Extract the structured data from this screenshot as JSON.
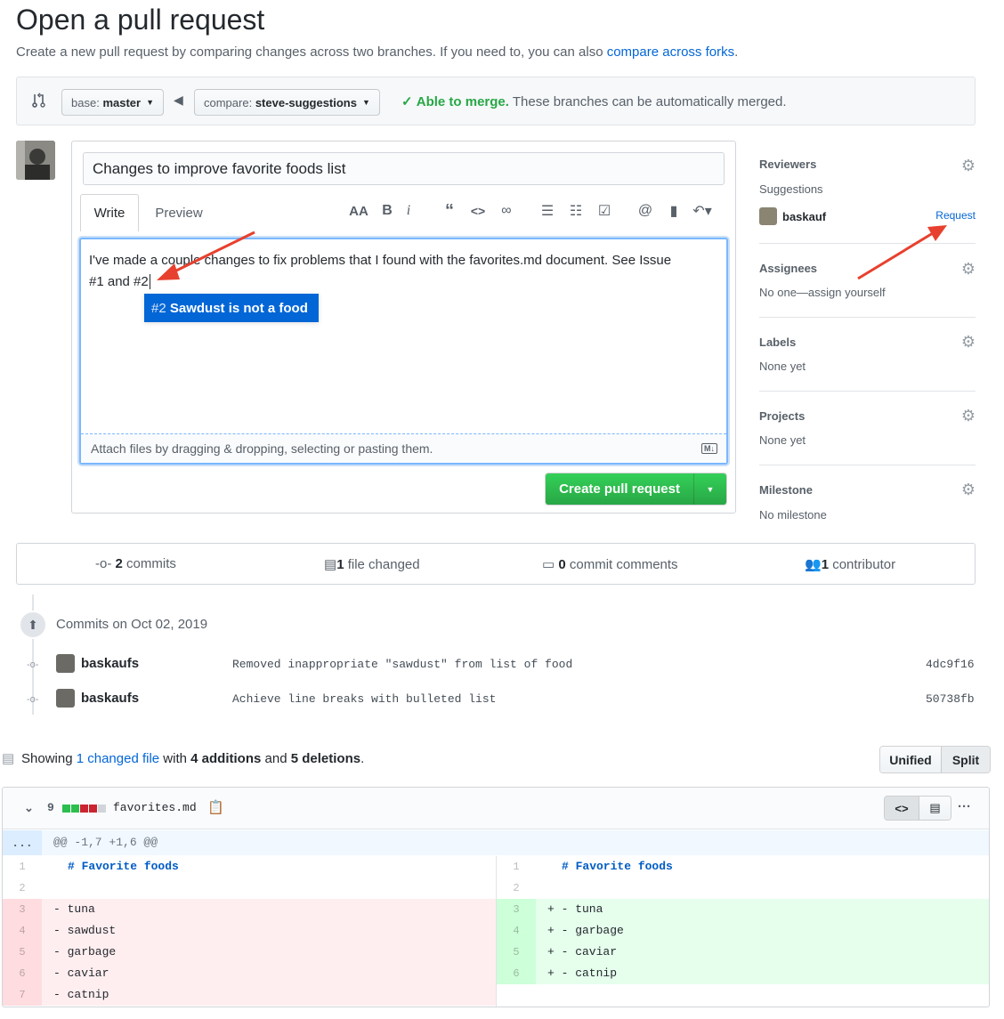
{
  "page": {
    "title": "Open a pull request",
    "subtitle_prefix": "Create a new pull request by comparing changes across two branches. If you need to, you can also",
    "subtitle_link": "compare across forks",
    "subtitle_suffix": "."
  },
  "compare_bar": {
    "base_label": "base:",
    "base_value": "master",
    "compare_label": "compare:",
    "compare_value": "steve-suggestions",
    "merge_status": "Able to merge.",
    "merge_detail": "These branches can be automatically merged."
  },
  "form": {
    "title_value": "Changes to improve favorite foods list",
    "tab_write": "Write",
    "tab_preview": "Preview",
    "body_text_line1": "I've made a couple changes to fix problems that I found with the favorites.md document.  See Issue",
    "body_text_line2": "#1 and #2",
    "suggestion_number": "#2",
    "suggestion_title": "Sawdust is not a food",
    "attach_text": "Attach files by dragging & dropping, selecting or pasting them.",
    "create_button": "Create pull request"
  },
  "sidebar": {
    "reviewers_title": "Reviewers",
    "suggestions_label": "Suggestions",
    "suggested_user": "baskauf",
    "request_link": "Request",
    "assignees_title": "Assignees",
    "assignees_value": "No one—assign yourself",
    "labels_title": "Labels",
    "labels_value": "None yet",
    "projects_title": "Projects",
    "projects_value": "None yet",
    "milestone_title": "Milestone",
    "milestone_value": "No milestone"
  },
  "stats": {
    "commits_count": "2",
    "commits_label": "commits",
    "files_count": "1",
    "files_label": "file changed",
    "comments_count": "0",
    "comments_label": "commit comments",
    "contributors_count": "1",
    "contributors_label": "contributor"
  },
  "commits": {
    "date_heading": "Commits on Oct 02, 2019",
    "items": [
      {
        "author": "baskaufs",
        "message": "Removed inappropriate \"sawdust\" from list of food",
        "sha": "4dc9f16"
      },
      {
        "author": "baskaufs",
        "message": "Achieve line breaks with bulleted list",
        "sha": "50738fb"
      }
    ]
  },
  "diff_summary": {
    "showing": "Showing",
    "changed_file_link": "1 changed file",
    "with": "with",
    "additions": "4 additions",
    "and": "and",
    "deletions": "5 deletions",
    "period": ".",
    "btn_unified": "Unified",
    "btn_split": "Split"
  },
  "file": {
    "change_count": "9",
    "filename": "favorites.md",
    "hunk_header": "@@ -1,7 +1,6 @@",
    "expand": "...",
    "left_lines": [
      {
        "num": "1",
        "text": "# Favorite foods",
        "type": "context"
      },
      {
        "num": "2",
        "text": "",
        "type": "context"
      },
      {
        "num": "3",
        "text": "- tuna",
        "type": "del"
      },
      {
        "num": "4",
        "text": "- sawdust",
        "type": "del"
      },
      {
        "num": "5",
        "text": "- garbage",
        "type": "del"
      },
      {
        "num": "6",
        "text": "- caviar",
        "type": "del"
      },
      {
        "num": "7",
        "text": "- catnip",
        "type": "del"
      }
    ],
    "right_lines": [
      {
        "num": "1",
        "text": "# Favorite foods",
        "type": "context"
      },
      {
        "num": "2",
        "text": "",
        "type": "context"
      },
      {
        "num": "3",
        "text": "+ - tuna",
        "type": "add"
      },
      {
        "num": "4",
        "text": "+ - garbage",
        "type": "add"
      },
      {
        "num": "5",
        "text": "+ - caviar",
        "type": "add"
      },
      {
        "num": "6",
        "text": "+ - catnip",
        "type": "add"
      }
    ]
  },
  "colors": {
    "green": "#2cbe4e",
    "link_blue": "#0366d6",
    "del_bg": "#ffeef0",
    "del_num_bg": "#ffdce0",
    "add_bg": "#e6ffed",
    "add_num_bg": "#cdffd8",
    "annotation_red": "#e8402e"
  }
}
